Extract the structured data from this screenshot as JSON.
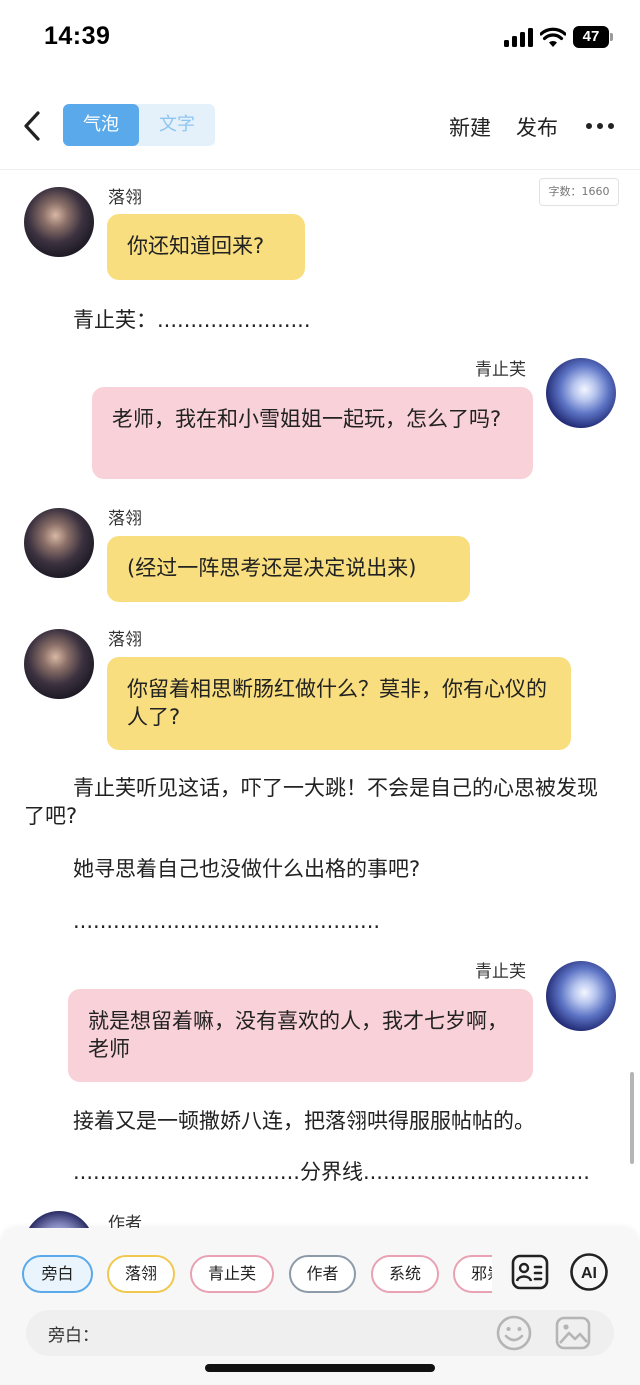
{
  "status": {
    "time": "14:39",
    "battery": "47"
  },
  "header": {
    "segments": [
      "气泡",
      "文字"
    ],
    "new_label": "新建",
    "publish_label": "发布"
  },
  "word_count": "字数：1660",
  "chat": {
    "s1_name": "落翎",
    "s1_text": "你还知道回来?",
    "p1": "青止芙：.......................",
    "s2_name": "青止芙",
    "s2_text": "老师，我在和小雪姐姐一起玩，怎么了吗?",
    "s3_name": "落翎",
    "s3_text": "(经过一阵思考还是决定说出来)",
    "s4_name": "落翎",
    "s4_text": "你留着相思断肠红做什么？莫非，你有心仪的人了?",
    "p2": "青止芙听见这话，吓了一大跳！不会是自己的心思被发现了吧?",
    "p3": "她寻思着自己也没做什么出格的事吧?",
    "p4": "..............................................",
    "s5_name": "青止芙",
    "s5_text": "就是想留着嘛，没有喜欢的人，我才七岁啊，老师",
    "p5": "接着又是一顿撒娇八连，把落翎哄得服服帖帖的。",
    "p6": "..................................分界线..................................",
    "s6_name": "作者"
  },
  "roles": [
    "旁白",
    "落翎",
    "青止芙",
    "作者",
    "系统",
    "邪祟"
  ],
  "ai_label": "AI",
  "input": {
    "label": "旁白："
  },
  "colors": {
    "accent": "#5aa9ea",
    "left_bubble": "#f8de7e",
    "right_bubble": "#f8d1d9"
  }
}
